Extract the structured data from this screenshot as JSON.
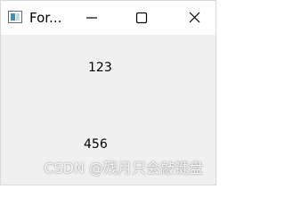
{
  "window": {
    "title": "For...",
    "icon": "form-app-icon"
  },
  "controls": {
    "minimize_icon": "minimize-icon",
    "maximize_icon": "maximize-icon",
    "close_icon": "close-icon"
  },
  "labels": [
    "123",
    "456"
  ],
  "watermark": "CSDN @残月只会敲键盘",
  "colors": {
    "client_background": "#f0f0f0",
    "titlebar_background": "#ffffff",
    "text": "#000000"
  }
}
